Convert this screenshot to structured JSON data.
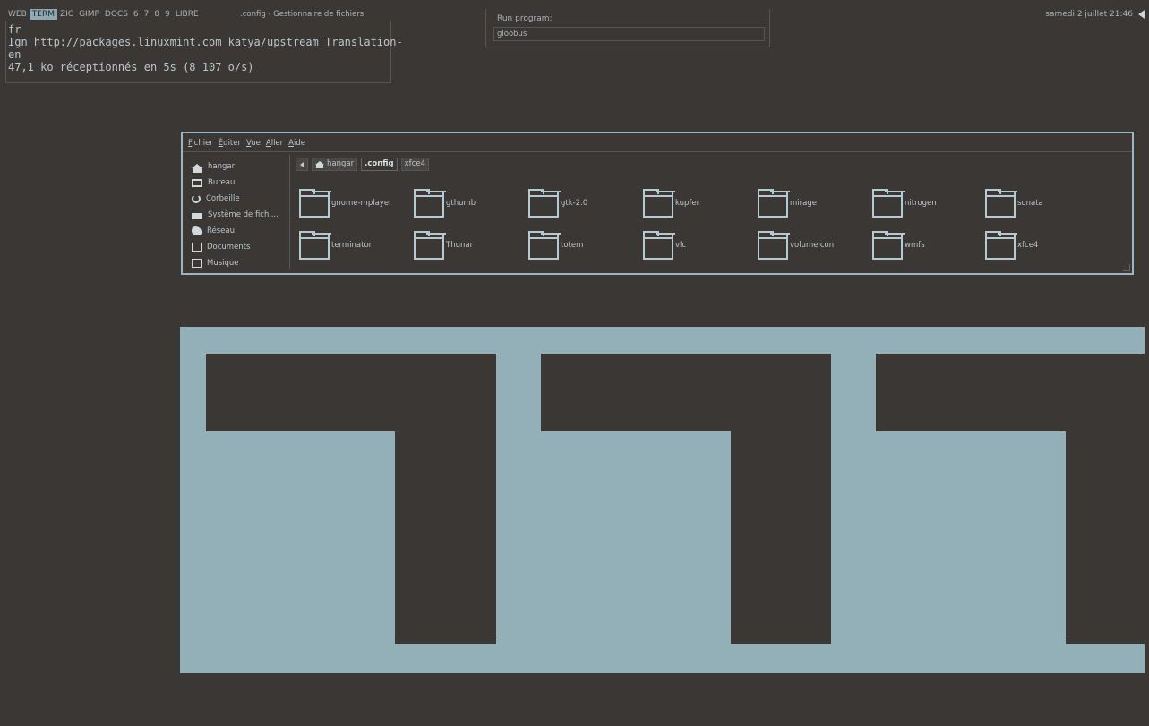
{
  "topbar": {
    "tags": [
      "WEB",
      "TERM",
      "ZIC",
      "GIMP",
      "DOCS",
      "6",
      "7",
      "8",
      "9",
      "LIBRE"
    ],
    "active_tag": "TERM",
    "window_title": ".config - Gestionnaire de fichiers",
    "clock": "samedi  2 juillet  21:46"
  },
  "terminal": {
    "lines": [
      "fr",
      "Ign http://packages.linuxmint.com katya/upstream Translation-",
      "en",
      "47,1 ko réceptionnés en 5s (8 107 o/s)"
    ]
  },
  "runbox": {
    "label": "Run program:",
    "value": "gloobus"
  },
  "filemanager": {
    "menu": [
      "Fichier",
      "Éditer",
      "Vue",
      "Aller",
      "Aide"
    ],
    "sidebar": [
      {
        "label": "hangar",
        "icon": "home-icon"
      },
      {
        "label": "Bureau",
        "icon": "desktop-icon"
      },
      {
        "label": "Corbeille",
        "icon": "trash-icon"
      },
      {
        "label": "Système de fichi...",
        "icon": "drive-icon"
      },
      {
        "label": "Réseau",
        "icon": "network-icon"
      },
      {
        "label": "Documents",
        "icon": "folder-icon"
      },
      {
        "label": "Musique",
        "icon": "folder-icon"
      }
    ],
    "path": [
      "hangar",
      ".config",
      "xfce4"
    ],
    "current_path": ".config",
    "folders": [
      "gnome-mplayer",
      "gthumb",
      "gtk-2.0",
      "kupfer",
      "mirage",
      "nitrogen",
      "sonata",
      "terminator",
      "Thunar",
      "totem",
      "vlc",
      "volumeicon",
      "wmfs",
      "xfce4"
    ]
  },
  "colors": {
    "background": "#3b3735",
    "accent": "#93b0b9",
    "border": "#9cb5c0"
  }
}
